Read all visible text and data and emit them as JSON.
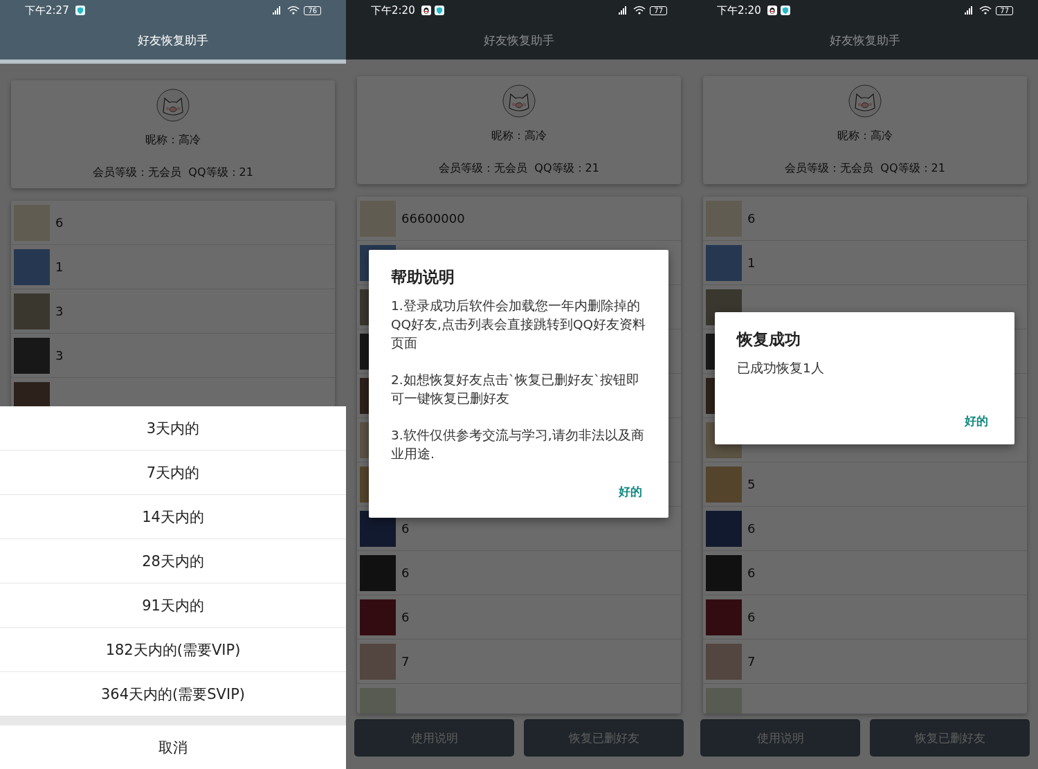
{
  "screens": [
    {
      "status_bar": {
        "time": "下午2:27",
        "notification_icons": [
          {
            "kind": "shield"
          }
        ],
        "battery": "76"
      },
      "app_bar": {
        "title": "好友恢复助手"
      },
      "profile": {
        "nickname": "昵称：高冷",
        "levels": "会员等级：无会员  QQ等级：21"
      },
      "friends": [
        {
          "kind": "named",
          "name": "6"
        },
        {
          "kind": "named",
          "name": "1"
        },
        {
          "kind": "named",
          "name": "3"
        },
        {
          "kind": "named",
          "name": "3"
        },
        {
          "kind": "avatar_only"
        }
      ],
      "overlay": {
        "kind": "action_sheet",
        "options": [
          "3天内的",
          "7天内的",
          "14天内的",
          "28天内的",
          "91天内的",
          "182天内的(需要VIP)",
          "364天内的(需要SVIP)"
        ],
        "cancel": "取消"
      }
    },
    {
      "status_bar": {
        "time": "下午2:20",
        "notification_icons": [
          {
            "kind": "penguin"
          },
          {
            "kind": "shield"
          }
        ],
        "battery": "77"
      },
      "app_bar": {
        "title": "好友恢复助手"
      },
      "profile": {
        "nickname": "昵称：高冷",
        "levels": "会员等级：无会员  QQ等级：21"
      },
      "friends": [
        {
          "kind": "named",
          "name": "66600000"
        },
        {
          "kind": "avatar_only"
        },
        {
          "kind": "avatar_only"
        },
        {
          "kind": "avatar_only"
        },
        {
          "kind": "avatar_only"
        },
        {
          "kind": "avatar_only"
        },
        {
          "kind": "avatar_only"
        },
        {
          "kind": "named",
          "name": "6"
        },
        {
          "kind": "named",
          "name": "6"
        },
        {
          "kind": "named",
          "name": "6"
        },
        {
          "kind": "named",
          "name": "7"
        },
        {
          "kind": "avatar_only"
        }
      ],
      "buttons": [
        "使用说明",
        "恢复已删好友"
      ],
      "overlay": {
        "kind": "dialog",
        "title": "帮助说明",
        "paragraphs": [
          "1.登录成功后软件会加载您一年内删除掉的QQ好友,点击列表会直接跳转到QQ好友资料页面",
          "2.如想恢复好友点击`恢复已删好友`按钮即可一键恢复已删好友",
          "3.软件仅供参考交流与学习,请勿非法以及商业用途."
        ],
        "ok": "好的"
      }
    },
    {
      "status_bar": {
        "time": "下午2:20",
        "notification_icons": [
          {
            "kind": "penguin"
          },
          {
            "kind": "shield"
          }
        ],
        "battery": "77"
      },
      "app_bar": {
        "title": "好友恢复助手"
      },
      "profile": {
        "nickname": "昵称：高冷",
        "levels": "会员等级：无会员  QQ等级：21"
      },
      "friends": [
        {
          "kind": "named",
          "name": "6"
        },
        {
          "kind": "named",
          "name": "1"
        },
        {
          "kind": "avatar_only"
        },
        {
          "kind": "avatar_only"
        },
        {
          "kind": "avatar_only"
        },
        {
          "kind": "avatar_only"
        },
        {
          "kind": "named",
          "name": "5"
        },
        {
          "kind": "named",
          "name": "6"
        },
        {
          "kind": "named",
          "name": "6"
        },
        {
          "kind": "named",
          "name": "6"
        },
        {
          "kind": "named",
          "name": "7"
        },
        {
          "kind": "avatar_only"
        }
      ],
      "buttons": [
        "使用说明",
        "恢复已删好友"
      ],
      "overlay": {
        "kind": "dialog",
        "title": "恢复成功",
        "paragraphs": [
          "已成功恢复1人"
        ],
        "ok": "好的"
      }
    }
  ]
}
